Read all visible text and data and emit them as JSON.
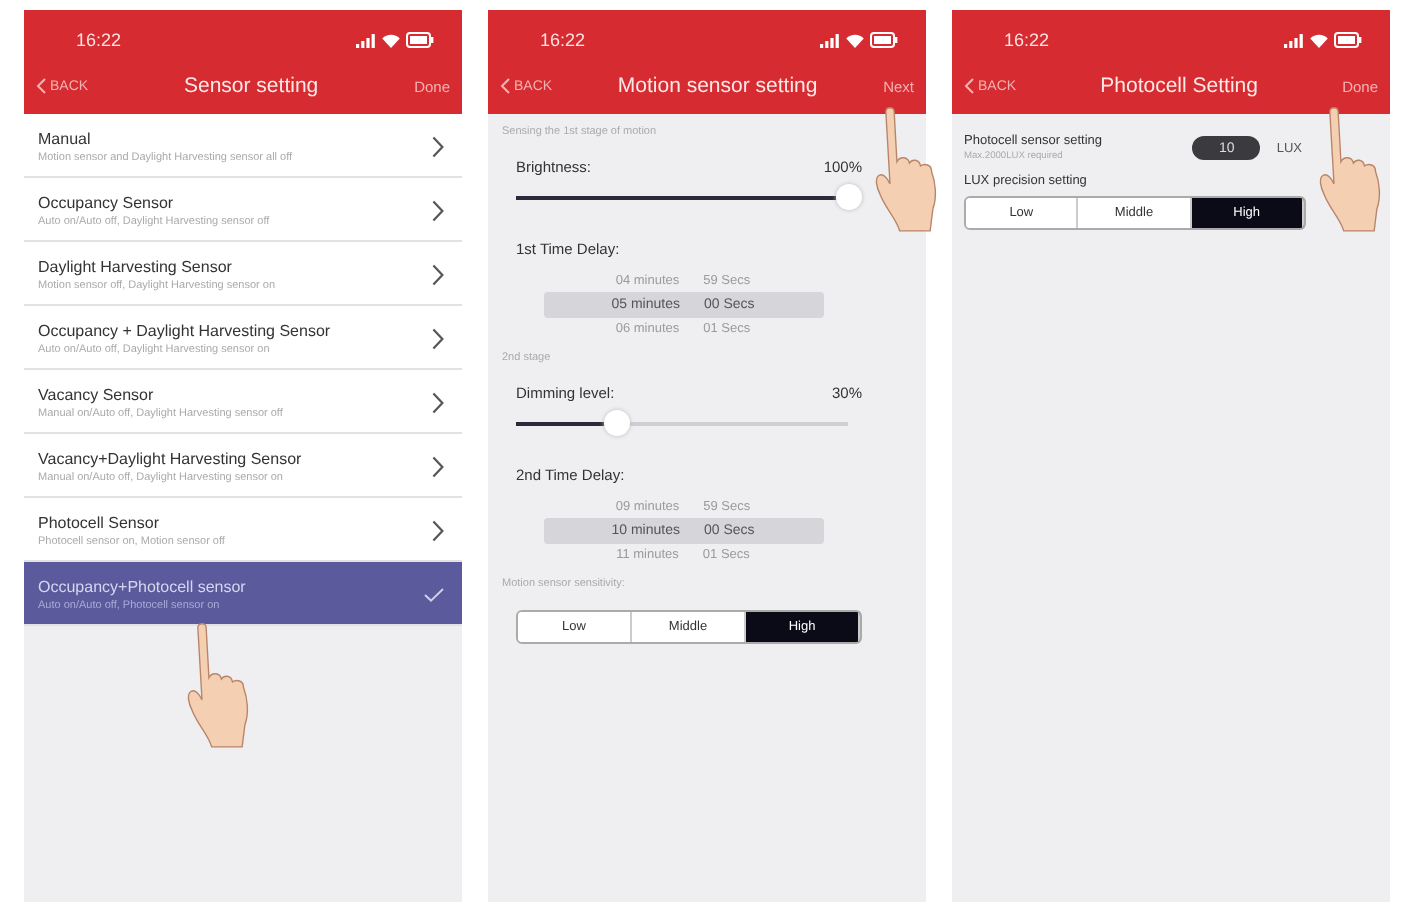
{
  "screens": [
    {
      "kind": "list",
      "status_time": "16:22",
      "nav": {
        "back": "BACK",
        "title": "Sensor setting",
        "action": "Done"
      },
      "items": [
        {
          "title": "Manual",
          "subtitle": "Motion sensor and Daylight Harvesting sensor all off",
          "selected": false
        },
        {
          "title": "Occupancy Sensor",
          "subtitle": "Auto on/Auto off, Daylight Harvesting sensor off",
          "selected": false
        },
        {
          "title": "Daylight Harvesting Sensor",
          "subtitle": "Motion sensor off,  Daylight Harvesting sensor on",
          "selected": false
        },
        {
          "title": "Occupancy + Daylight Harvesting Sensor",
          "subtitle": "Auto on/Auto off, Daylight Harvesting sensor on",
          "selected": false
        },
        {
          "title": "Vacancy Sensor",
          "subtitle": "Manual on/Auto off, Daylight Harvesting sensor off",
          "selected": false
        },
        {
          "title": "Vacancy+Daylight Harvesting Sensor",
          "subtitle": "Manual on/Auto off, Daylight Harvesting sensor on",
          "selected": false
        },
        {
          "title": "Photocell Sensor",
          "subtitle": "Photocell sensor on, Motion sensor off",
          "selected": false
        },
        {
          "title": "Occupancy+Photocell sensor",
          "subtitle": "Auto on/Auto off, Photocell sensor on",
          "selected": true
        }
      ]
    },
    {
      "kind": "motion",
      "status_time": "16:22",
      "nav": {
        "back": "BACK",
        "title": "Motion sensor setting",
        "action": "Next"
      },
      "stage1_caption": "Sensing the 1st stage of motion",
      "brightness": {
        "label": "Brightness:",
        "reading": "100%",
        "level": 1.0
      },
      "delay1": {
        "label": "1st Time Delay:",
        "rows": [
          {
            "minutes": "04 minutes",
            "secs": "59 Secs",
            "selected": false
          },
          {
            "minutes": "05 minutes",
            "secs": "00 Secs",
            "selected": true
          },
          {
            "minutes": "06 minutes",
            "secs": "01 Secs",
            "selected": false
          }
        ]
      },
      "stage2_caption": "2nd stage",
      "dimming": {
        "label": "Dimming level:",
        "reading": "30%",
        "level": 0.3
      },
      "delay2": {
        "label": "2nd Time Delay:",
        "rows": [
          {
            "minutes": "09 minutes",
            "secs": "59 Secs",
            "selected": false
          },
          {
            "minutes": "10 minutes",
            "secs": "00 Secs",
            "selected": true
          },
          {
            "minutes": "11 minutes",
            "secs": "01 Secs",
            "selected": false
          }
        ]
      },
      "sensitivity": {
        "label": "Motion sensor sensitivity:",
        "options": [
          {
            "label": "Low",
            "selected": false
          },
          {
            "label": "Middle",
            "selected": false
          },
          {
            "label": "High",
            "selected": true
          }
        ]
      }
    },
    {
      "kind": "photocell",
      "status_time": "16:22",
      "nav": {
        "back": "BACK",
        "title": "Photocell Setting",
        "action": "Done"
      },
      "setting": {
        "label": "Photocell sensor setting",
        "hint": "Max.2000LUX required",
        "value": "10",
        "unit": "LUX"
      },
      "precision": {
        "label": "LUX precision setting",
        "options": [
          {
            "label": "Low",
            "selected": false
          },
          {
            "label": "Middle",
            "selected": false
          },
          {
            "label": "High",
            "selected": true
          }
        ]
      }
    }
  ]
}
